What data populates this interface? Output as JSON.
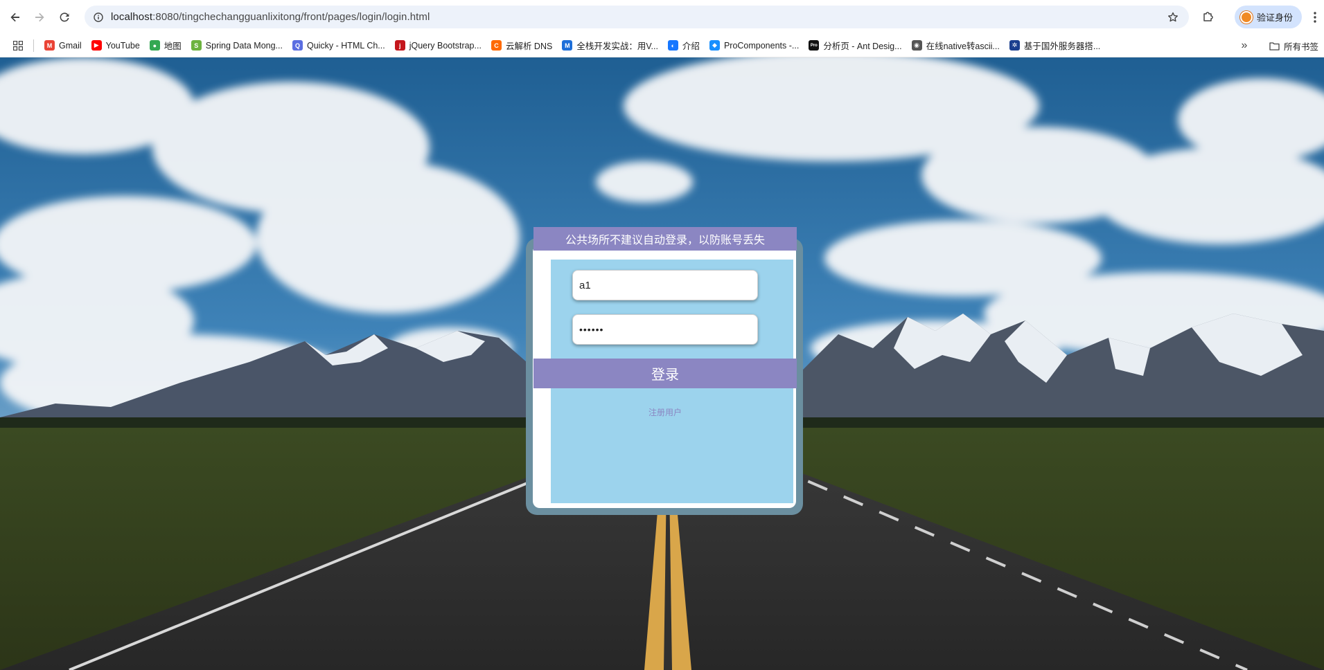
{
  "browser": {
    "url_host": "localhost",
    "url_path": ":8080/tingchechangguanlixitong/front/pages/login/login.html",
    "profile_label": "验证身份",
    "bookmarks": [
      {
        "label": "Gmail",
        "color": "#ea4335",
        "glyph": "M"
      },
      {
        "label": "YouTube",
        "color": "#ff0000",
        "glyph": "▶"
      },
      {
        "label": "地图",
        "color": "#34a853",
        "glyph": "●"
      },
      {
        "label": "Spring Data Mong...",
        "color": "#6db33f",
        "glyph": "S"
      },
      {
        "label": "Quicky - HTML Ch...",
        "color": "#5b6ee1",
        "glyph": "Q"
      },
      {
        "label": "jQuery Bootstrap...",
        "color": "#c4161c",
        "glyph": "j"
      },
      {
        "label": "云解析 DNS",
        "color": "#ff6a00",
        "glyph": "C"
      },
      {
        "label": "全栈开发实战：用V...",
        "color": "#1e6fd9",
        "glyph": "M"
      },
      {
        "label": "介绍",
        "color": "#1677ff",
        "glyph": "◐"
      },
      {
        "label": "ProComponents -...",
        "color": "#1890ff",
        "glyph": "◆"
      },
      {
        "label": "分析页 - Ant Desig...",
        "color": "#111111",
        "glyph": "Pro"
      },
      {
        "label": "在线native转ascii...",
        "color": "#555555",
        "glyph": "◉"
      },
      {
        "label": "基于国外服务器搭...",
        "color": "#1b3f8f",
        "glyph": "✲"
      }
    ],
    "all_bookmarks_label": "所有书签"
  },
  "login": {
    "notice": "公共场所不建议自动登录，以防账号丢失",
    "username_value": "a1",
    "password_value": "••••••",
    "login_button": "登录",
    "register_link": "注册用户"
  },
  "colors": {
    "accent": "#8b86c2",
    "panel": "#9cd3ed",
    "frame": "#6b8fa0"
  }
}
